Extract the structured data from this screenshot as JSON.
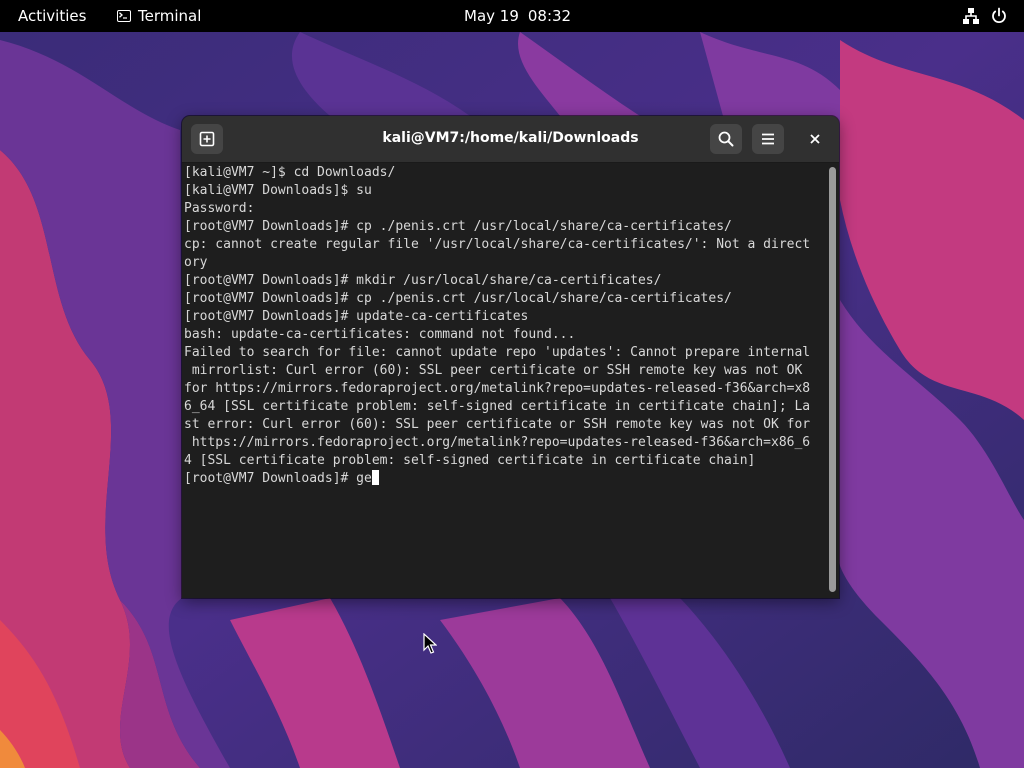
{
  "topbar": {
    "activities": "Activities",
    "app_name": "Terminal",
    "app_icon": "terminal-icon",
    "date": "May 19",
    "time": "08:32",
    "network_icon": "network-icon",
    "power_icon": "power-icon"
  },
  "window": {
    "title": "kali@VM7:/home/kali/Downloads",
    "new_tab_icon": "new-tab-icon",
    "search_icon": "search-icon",
    "menu_icon": "hamburger-menu-icon",
    "close_icon": "close-icon"
  },
  "terminal": {
    "lines": [
      "[kali@VM7 ~]$ cd Downloads/",
      "[kali@VM7 Downloads]$ su",
      "Password:",
      "[root@VM7 Downloads]# cp ./penis.crt /usr/local/share/ca-certificates/",
      "cp: cannot create regular file '/usr/local/share/ca-certificates/': Not a direct",
      "ory",
      "[root@VM7 Downloads]# mkdir /usr/local/share/ca-certificates/",
      "[root@VM7 Downloads]# cp ./penis.crt /usr/local/share/ca-certificates/",
      "[root@VM7 Downloads]# update-ca-certificates",
      "bash: update-ca-certificates: command not found...",
      "Failed to search for file: cannot update repo 'updates': Cannot prepare internal",
      " mirrorlist: Curl error (60): SSL peer certificate or SSH remote key was not OK",
      "for https://mirrors.fedoraproject.org/metalink?repo=updates-released-f36&arch=x8",
      "6_64 [SSL certificate problem: self-signed certificate in certificate chain]; La",
      "st error: Curl error (60): SSL peer certificate or SSH remote key was not OK for",
      " https://mirrors.fedoraproject.org/metalink?repo=updates-released-f36&arch=x86_6",
      "4 [SSL certificate problem: self-signed certificate in certificate chain]"
    ],
    "prompt_line": "[root@VM7 Downloads]# ge"
  },
  "colors": {
    "topbar_bg": "#000000",
    "terminal_bg": "#1e1e1e",
    "headerbar_bg": "#303030",
    "terminal_text": "#d8d8d8"
  }
}
